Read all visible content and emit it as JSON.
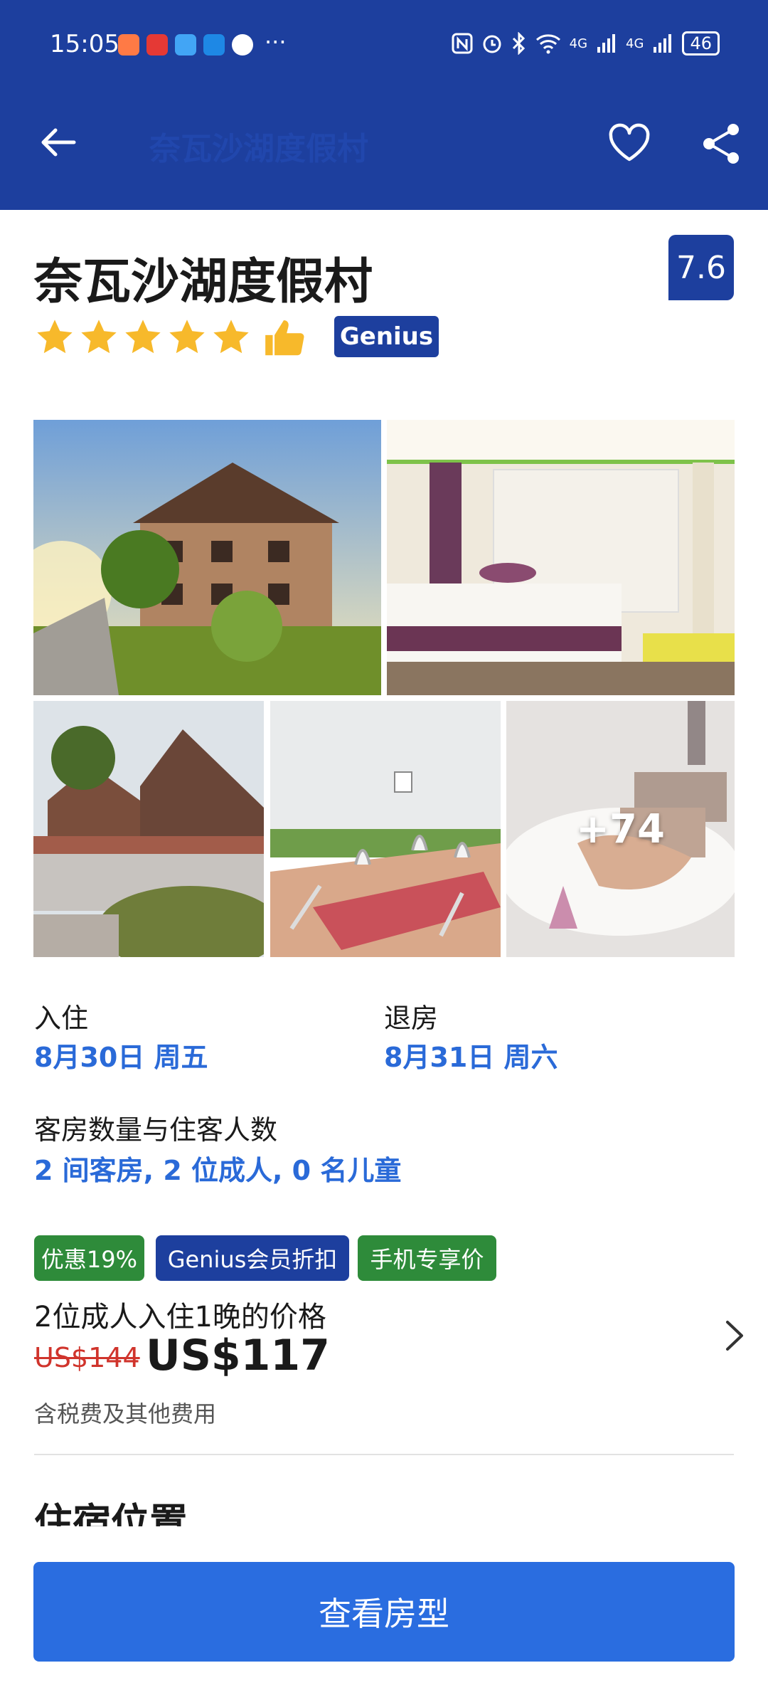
{
  "status_bar": {
    "time": "15:05",
    "dots": "···",
    "network_label_1": "4G",
    "network_label_2": "4G",
    "battery": "46"
  },
  "nav": {
    "title": "奈瓦沙湖度假村",
    "back_icon": "arrow-left-icon",
    "favorite_icon": "heart-outline-icon",
    "share_icon": "share-icon"
  },
  "hotel": {
    "name": "奈瓦沙湖度假村",
    "review_score": "7.6",
    "star_count": 5,
    "genius_label": "Genius"
  },
  "gallery": {
    "more_label": "+74",
    "photos": [
      "hotel-exterior",
      "guest-room",
      "lodge-roof",
      "dining-table",
      "food-dish"
    ]
  },
  "stay": {
    "checkin_label": "入住",
    "checkin_value": "8月30日 周五",
    "checkout_label": "退房",
    "checkout_value": "8月31日 周六",
    "rooms_label": "客房数量与住客人数",
    "rooms_value": "2 间客房, 2 位成人, 0 名儿童"
  },
  "deals": {
    "discount": "优惠19%",
    "genius": "Genius会员折扣",
    "mobile": "手机专享价"
  },
  "price": {
    "caption": "2位成人入住1晚的价格",
    "original": "US$144",
    "current": "US$117",
    "tax_note": "含税费及其他费用"
  },
  "location": {
    "title": "住宿位置"
  },
  "cta": {
    "label": "查看房型"
  },
  "colors": {
    "header": "#1d3f9e",
    "accent_blue": "#2a6ad8",
    "cta": "#2a6de0",
    "deal_green": "#2e8b3a",
    "strike_red": "#d0342c",
    "star": "#f7b92b"
  }
}
